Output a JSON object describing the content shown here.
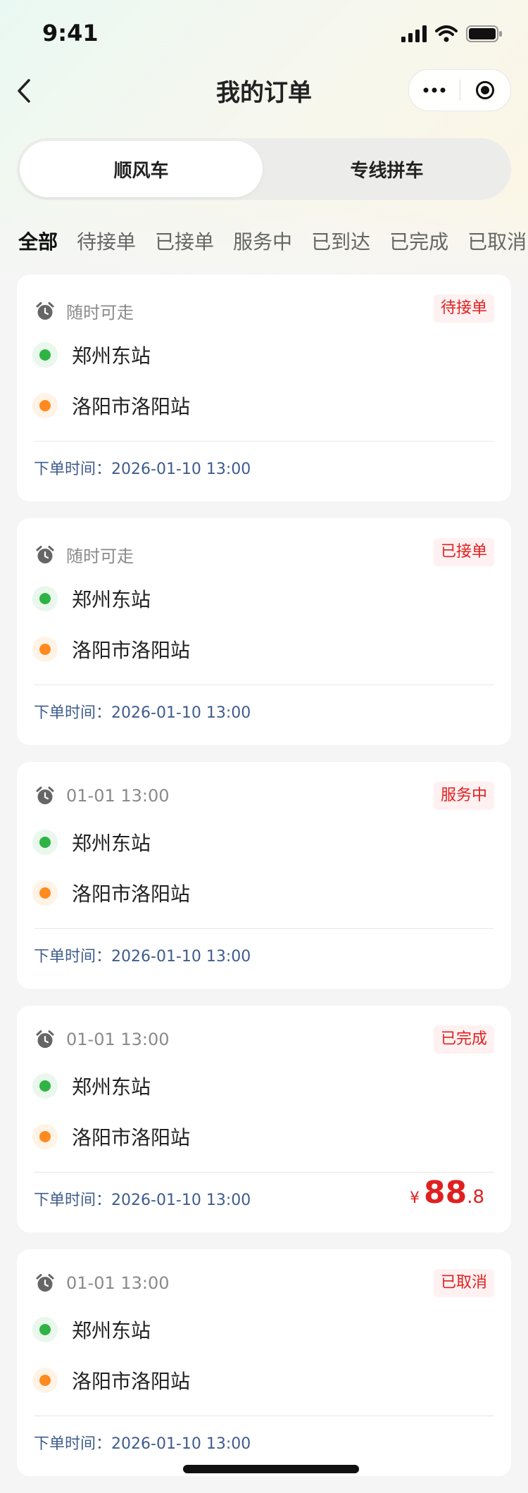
{
  "status_bar": {
    "time": "9:41"
  },
  "nav": {
    "title": "我的订单"
  },
  "segments": {
    "active": "顺风车",
    "inactive": "专线拼车"
  },
  "tabs": [
    "全部",
    "待接单",
    "已接单",
    "服务中",
    "已到达",
    "已完成",
    "已取消"
  ],
  "orders": [
    {
      "depart_time": "随时可走",
      "status": "待接单",
      "from": "郑州东站",
      "to": "洛阳市洛阳站",
      "order_time_label": "下单时间：",
      "order_time": "2026-01-10 13:00"
    },
    {
      "depart_time": "随时可走",
      "status": "已接单",
      "from": "郑州东站",
      "to": "洛阳市洛阳站",
      "order_time_label": "下单时间：",
      "order_time": "2026-01-10 13:00"
    },
    {
      "depart_time": "01-01 13:00",
      "status": "服务中",
      "from": "郑州东站",
      "to": "洛阳市洛阳站",
      "order_time_label": "下单时间：",
      "order_time": "2026-01-10 13:00"
    },
    {
      "depart_time": "01-01 13:00",
      "status": "已完成",
      "from": "郑州东站",
      "to": "洛阳市洛阳站",
      "order_time_label": "下单时间：",
      "order_time": "2026-01-10 13:00",
      "price": {
        "currency": "¥",
        "integer": "88",
        "decimal": ".8"
      }
    },
    {
      "depart_time": "01-01 13:00",
      "status": "已取消",
      "from": "郑州东站",
      "to": "洛阳市洛阳站",
      "order_time_label": "下单时间：",
      "order_time": "2026-01-10 13:00"
    }
  ],
  "colors": {
    "accent_red": "#e02020",
    "start_dot": "#2fb344",
    "end_dot": "#ff8a1f",
    "time_blue": "#3f5c8c"
  }
}
